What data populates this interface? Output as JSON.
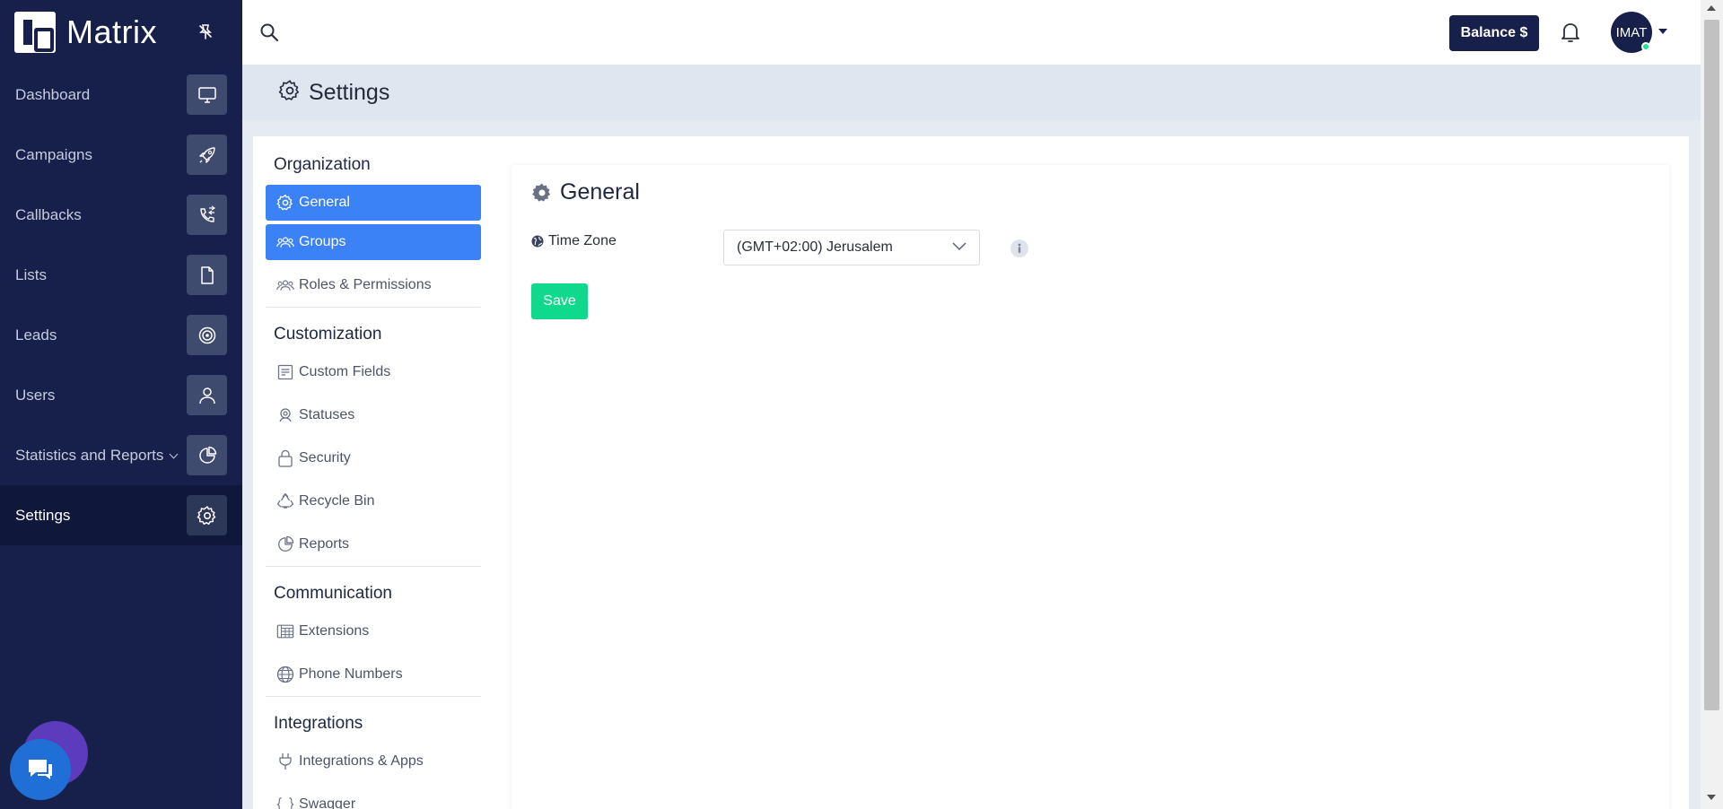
{
  "app": {
    "name": "Matrix"
  },
  "sidebar": {
    "items": [
      {
        "label": "Dashboard",
        "icon": "monitor-icon"
      },
      {
        "label": "Campaigns",
        "icon": "rocket-icon"
      },
      {
        "label": "Callbacks",
        "icon": "phone-callback-icon"
      },
      {
        "label": "Lists",
        "icon": "document-icon"
      },
      {
        "label": "Leads",
        "icon": "target-icon"
      },
      {
        "label": "Users",
        "icon": "user-icon"
      },
      {
        "label": "Statistics and Reports",
        "icon": "pie-chart-icon"
      },
      {
        "label": "Settings",
        "icon": "gear-icon",
        "active": true
      }
    ]
  },
  "topbar": {
    "balance_label": "Balance $",
    "avatar_initials": "IMAT"
  },
  "page": {
    "title": "Settings"
  },
  "subnav": {
    "organization": {
      "title": "Organization",
      "items": [
        {
          "label": "General",
          "icon": "gear-icon"
        },
        {
          "label": "Groups",
          "icon": "group-icon"
        },
        {
          "label": "Roles & Permissions",
          "icon": "group-icon"
        }
      ]
    },
    "customization": {
      "title": "Customization",
      "items": [
        {
          "label": "Custom Fields",
          "icon": "form-icon"
        },
        {
          "label": "Statuses",
          "icon": "status-icon"
        },
        {
          "label": "Security",
          "icon": "lock-icon"
        },
        {
          "label": "Recycle Bin",
          "icon": "recycle-icon"
        },
        {
          "label": "Reports",
          "icon": "pie-chart-icon"
        }
      ]
    },
    "communication": {
      "title": "Communication",
      "items": [
        {
          "label": "Extensions",
          "icon": "extensions-icon"
        },
        {
          "label": "Phone Numbers",
          "icon": "globe-icon"
        }
      ]
    },
    "integrations": {
      "title": "Integrations",
      "items": [
        {
          "label": "Integrations & Apps",
          "icon": "plug-icon"
        },
        {
          "label": "Swagger",
          "icon": "braces-icon"
        }
      ]
    }
  },
  "general": {
    "title": "General",
    "timezone_label": "Time Zone",
    "timezone_value": "(GMT+02:00) Jerusalem",
    "save_label": "Save"
  },
  "colors": {
    "sidebar_bg": "#17204b",
    "active_blue": "#3b82f6",
    "save_green": "#11d98c",
    "status_online": "#1ee58a"
  }
}
